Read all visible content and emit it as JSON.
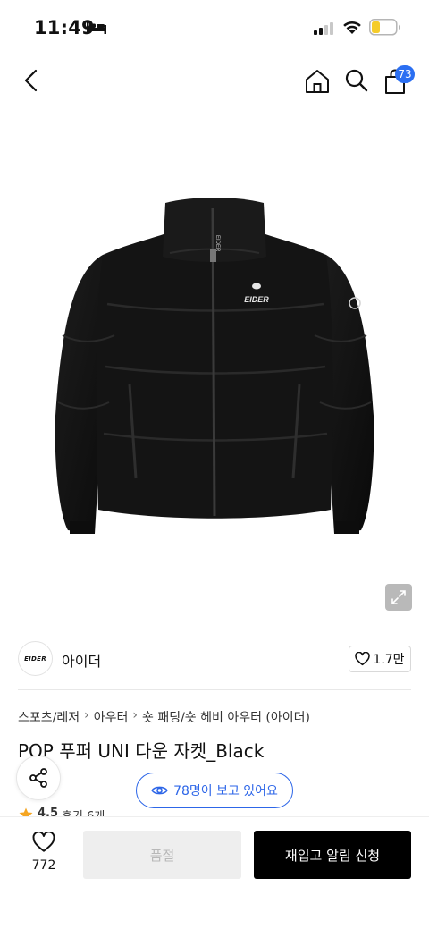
{
  "status_bar": {
    "time": "11:49",
    "battery_color": "#f5cc2a"
  },
  "nav": {
    "cart_count": "73",
    "badge_color": "#2b6ff2"
  },
  "product_image": {
    "logo_text": "EIDER",
    "collar_text": "EIDER"
  },
  "brand": {
    "logo_text": "EIDER",
    "name": "아이더",
    "like_count": "1.7만"
  },
  "breadcrumb": [
    "스포츠/레저",
    "아우터",
    "숏 패딩/숏 헤비 아우터 (아이더)"
  ],
  "product": {
    "title": "POP 푸퍼 UNI 다운 자켓_Black",
    "viewers_text": "78명이 보고 있어요",
    "rating": "4.5",
    "review_label": "후기 6개"
  },
  "bottom_bar": {
    "wish_count": "772",
    "soldout_label": "품절",
    "restock_label": "재입고 알림 신청"
  },
  "colors": {
    "accent": "#2d66e8",
    "star": "#f5a623"
  }
}
